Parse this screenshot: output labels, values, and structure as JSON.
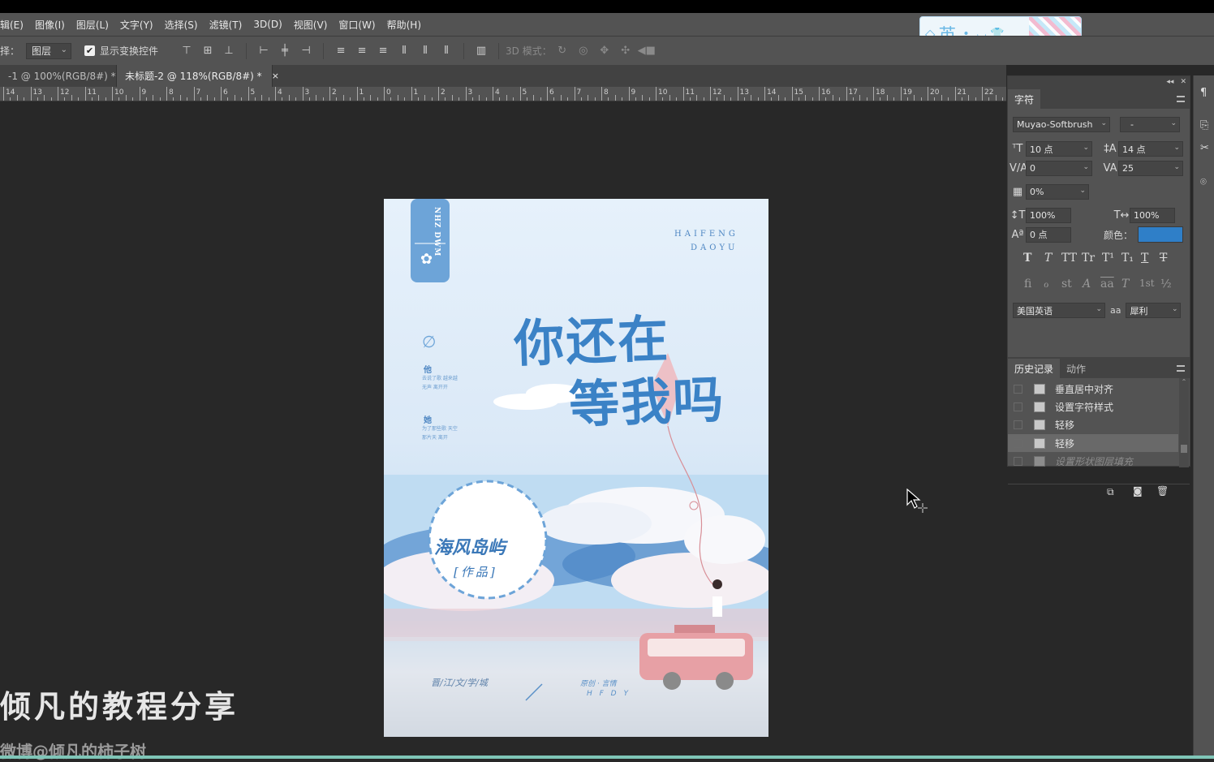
{
  "menu": [
    "编辑(E)",
    "图像(I)",
    "图层(L)",
    "文字(Y)",
    "选择(S)",
    "滤镜(T)",
    "3D(D)",
    "视图(V)",
    "窗口(W)",
    "帮助(H)"
  ],
  "menu_first": "辑(E)",
  "ime": {
    "label": "英"
  },
  "options": {
    "select_label": "择：",
    "select_value": "图层",
    "transform_check": "显示变换控件",
    "mode3d": "3D 模式："
  },
  "tabs": [
    {
      "label": "-1 @ 100%(RGB/8#) *",
      "close": "×"
    },
    {
      "label": "未标题-2 @ 118%(RGB/8#) *",
      "close": "×"
    }
  ],
  "ruler": [
    "14",
    "13",
    "12",
    "11",
    "10",
    "9",
    "8",
    "7",
    "6",
    "5",
    "4",
    "3",
    "2",
    "1",
    "0",
    "1",
    "2",
    "3",
    "4",
    "5",
    "6",
    "7",
    "8",
    "9",
    "10",
    "11",
    "12",
    "13",
    "14",
    "15",
    "16",
    "17",
    "18",
    "19",
    "20",
    "21",
    "22"
  ],
  "doc": {
    "badge": "NHZ DWM",
    "pinyin1": "HAIFENG",
    "pinyin2": "DAOYU",
    "title1": "你还在",
    "title2": "等我吗",
    "side_mark": "∅",
    "side_word1": "他",
    "side_text1": "去说了歌 越来越无声 离开开",
    "side_word2": "她",
    "side_text2": "为了那些歌 天空那片天 离开",
    "circle_name": "海风岛屿",
    "circle_sub": "[作品]",
    "footer_left": "晋/江/文/学/城",
    "footer_right1": "原创 · 言情",
    "footer_right2": "H F D Y"
  },
  "watermark": {
    "title": "倾凡的教程分享",
    "sub": "微博@倾凡的柿子树"
  },
  "char_panel": {
    "tab1": "字符",
    "font_family": "Muyao-Softbrush",
    "font_style": "-",
    "size": "10 点",
    "leading": "14 点",
    "kerning": "0",
    "tracking": "25",
    "tsume": "0%",
    "vscale": "100%",
    "hscale": "100%",
    "baseline": "0 点",
    "color_label": "颜色：",
    "color": "#2f7fc8",
    "language": "美国英语",
    "aa_label": "aa",
    "aa_value": "犀利",
    "type_buttons": [
      "T",
      "T",
      "TT",
      "Tr",
      "T¹",
      "T₁",
      "T",
      "T"
    ],
    "ot_buttons": [
      "ﬁ",
      "ℴ",
      "st",
      "A",
      "aa",
      "T",
      "1st",
      "½"
    ]
  },
  "history_panel": {
    "tab1": "历史记录",
    "tab2": "动作",
    "items": [
      "垂直居中对齐",
      "设置字符样式",
      "轻移",
      "轻移",
      "设置形状图层填充"
    ]
  }
}
